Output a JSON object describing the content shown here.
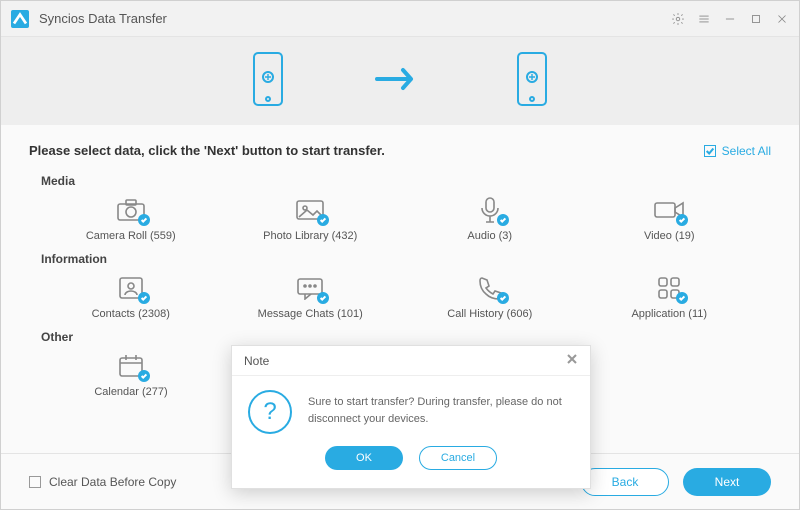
{
  "app": {
    "title": "Syncios Data Transfer"
  },
  "instruction": "Please select data, click the 'Next' button to start transfer.",
  "select_all_label": "Select All",
  "sections": {
    "media": {
      "title": "Media",
      "items": [
        {
          "label": "Camera Roll (559)"
        },
        {
          "label": "Photo Library (432)"
        },
        {
          "label": "Audio (3)"
        },
        {
          "label": "Video (19)"
        }
      ]
    },
    "information": {
      "title": "Information",
      "items": [
        {
          "label": "Contacts (2308)"
        },
        {
          "label": "Message Chats (101)"
        },
        {
          "label": "Call History (606)"
        },
        {
          "label": "Application (11)"
        }
      ]
    },
    "other": {
      "title": "Other",
      "items": [
        {
          "label": "Calendar (277)"
        }
      ]
    }
  },
  "footer": {
    "clear_label": "Clear Data Before Copy",
    "back_label": "Back",
    "next_label": "Next"
  },
  "modal": {
    "title": "Note",
    "message": "Sure to start transfer? During transfer, please do not disconnect your devices.",
    "ok_label": "OK",
    "cancel_label": "Cancel"
  }
}
